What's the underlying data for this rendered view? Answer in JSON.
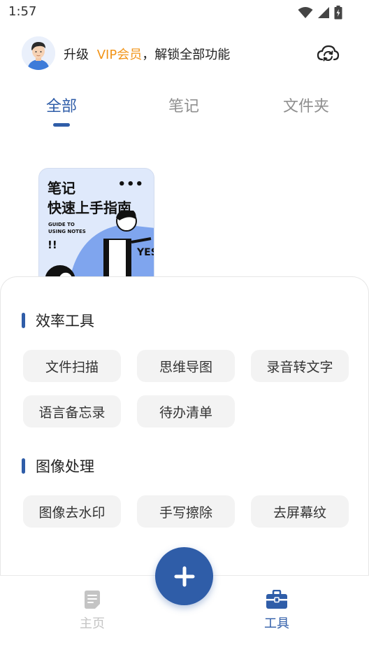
{
  "status_bar": {
    "time": "1:57"
  },
  "header": {
    "vip_prefix": "升级",
    "vip_highlight": "VIP会员",
    "vip_suffix": "，解锁全部功能"
  },
  "tabs": [
    {
      "label": "全部",
      "active": true
    },
    {
      "label": "笔记",
      "active": false
    },
    {
      "label": "文件夹",
      "active": false
    }
  ],
  "note_card": {
    "title_line1": "笔记",
    "title_line2": "快速上手指南",
    "subtitle_line1": "GUIDE TO",
    "subtitle_line2": "USING NOTES",
    "exclaim": "!!",
    "yes": "YES"
  },
  "tools": {
    "sections": [
      {
        "title": "效率工具",
        "items": [
          "文件扫描",
          "思维导图",
          "录音转文字",
          "语言备忘录",
          "待办清单"
        ]
      },
      {
        "title": "图像处理",
        "items": [
          "图像去水印",
          "手写擦除",
          "去屏幕纹"
        ]
      }
    ]
  },
  "bottom_nav": {
    "home_label": "主页",
    "tools_label": "工具"
  },
  "colors": {
    "accent": "#2f5da8",
    "vip_orange": "#f29418",
    "inactive": "#8f8f8f",
    "chip_bg": "#f3f3f3"
  },
  "icons": {
    "wifi": "wifi-icon",
    "signal": "signal-icon",
    "battery": "battery-icon",
    "sync": "cloud-sync-icon",
    "add": "plus-icon",
    "home": "document-icon",
    "tools": "toolbox-icon"
  }
}
